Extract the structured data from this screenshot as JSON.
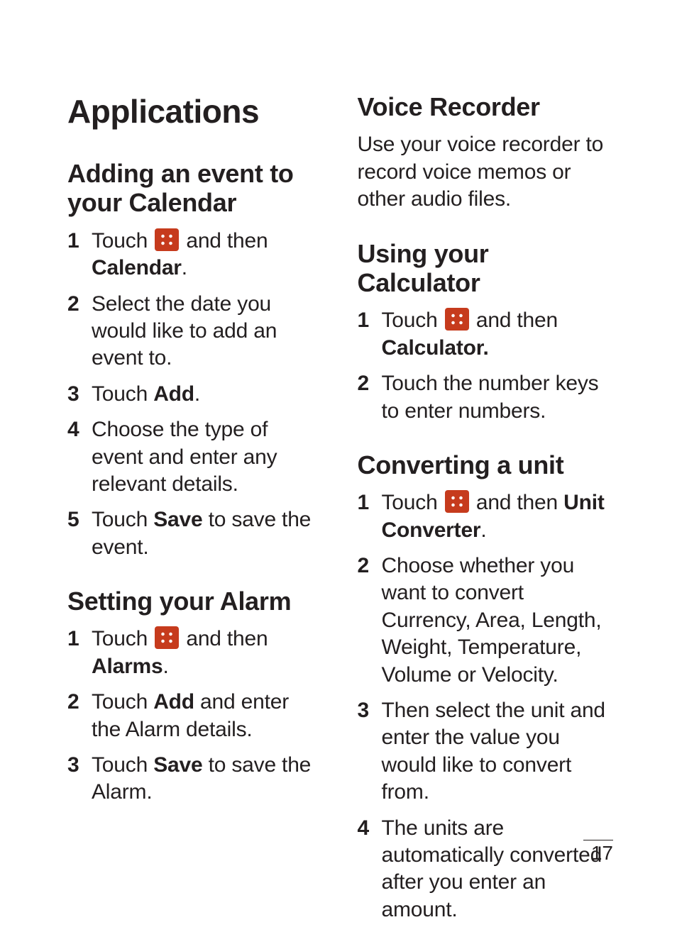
{
  "title": "Applications",
  "page_number": "17",
  "left": {
    "s1": {
      "heading": "Adding an event to your Calendar",
      "steps": [
        {
          "pre": "Touch ",
          "icon": "apps",
          "post": " and then ",
          "bold": "Calendar",
          "tail": "."
        },
        {
          "text": "Select the date you would like to add an event to."
        },
        {
          "pre": "Touch ",
          "bold": "Add",
          "tail": "."
        },
        {
          "text": "Choose the type of event and enter any relevant details."
        },
        {
          "pre": "Touch ",
          "bold": "Save",
          "tail": " to save the event."
        }
      ]
    },
    "s2": {
      "heading": "Setting your Alarm",
      "steps": [
        {
          "pre": "Touch ",
          "icon": "apps",
          "post": " and then ",
          "bold": "Alarms",
          "tail": "."
        },
        {
          "pre": "Touch ",
          "bold": "Add",
          "tail": " and enter the Alarm details."
        },
        {
          "pre": "Touch ",
          "bold": "Save",
          "tail": " to save the Alarm."
        }
      ]
    }
  },
  "right": {
    "s1": {
      "heading": "Voice Recorder",
      "body": "Use your voice recorder to record voice memos or other audio files."
    },
    "s2": {
      "heading": "Using your Calculator",
      "steps": [
        {
          "pre": "Touch ",
          "icon": "apps",
          "post": " and then ",
          "bold": "Calculator.",
          "tail": ""
        },
        {
          "text": "Touch the number keys to enter numbers."
        }
      ]
    },
    "s3": {
      "heading": "Converting a unit",
      "steps": [
        {
          "pre": "Touch ",
          "icon": "apps",
          "post": " and then ",
          "bold": "Unit Converter",
          "tail": "."
        },
        {
          "text": "Choose whether you want to convert Currency, Area, Length, Weight, Temperature, Volume or Velocity."
        },
        {
          "text": "Then select the unit and enter the value you would like to convert from."
        },
        {
          "text": "The units are automatically converted after you enter an amount."
        }
      ]
    }
  }
}
